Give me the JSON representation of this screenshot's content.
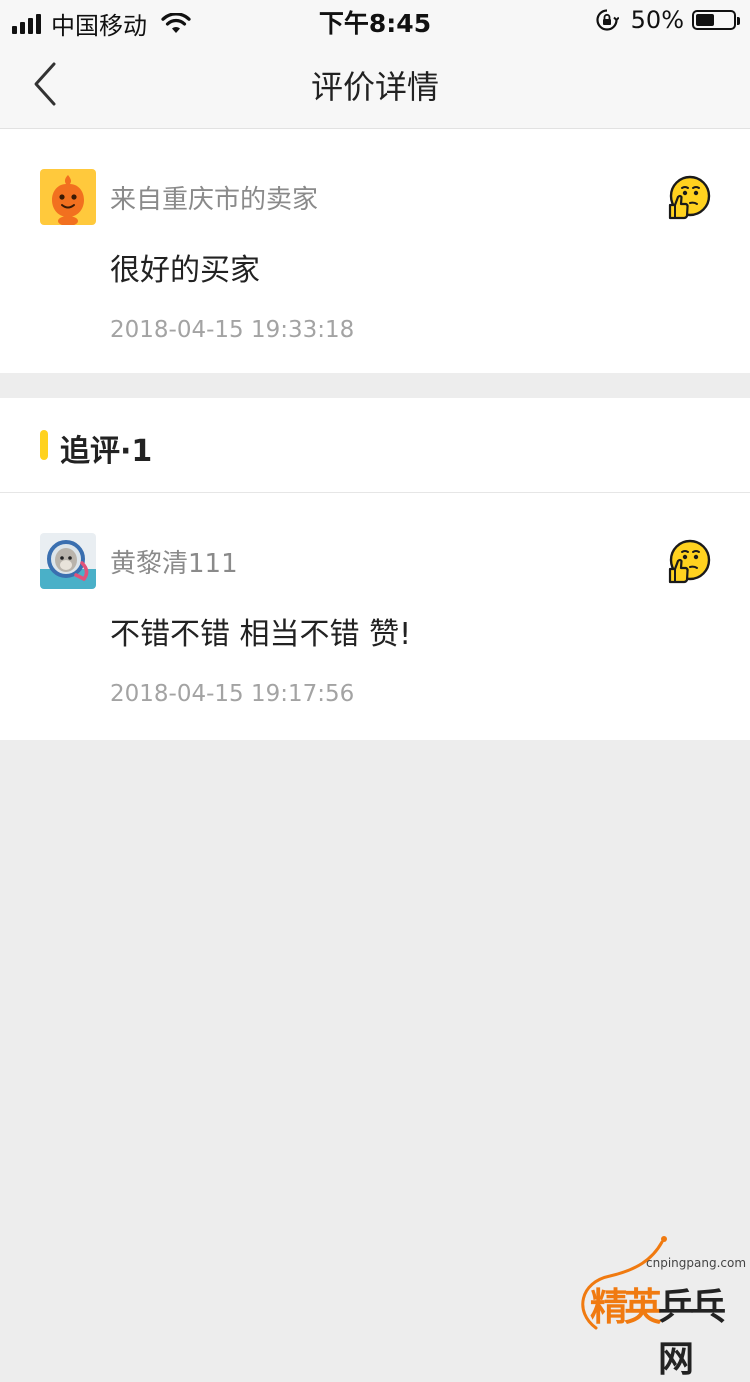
{
  "status_bar": {
    "carrier": "中国移动",
    "time": "下午8:45",
    "battery_percent": "50%",
    "battery_level": 0.5,
    "signal_bars": 4
  },
  "nav": {
    "title": "评价详情",
    "back_icon": "chevron-left-icon"
  },
  "review": {
    "user": "来自重庆市的卖家",
    "text": "很好的买家",
    "time": "2018-04-15 19:33:18",
    "rating_icon": "thumbs-up-face-icon"
  },
  "followup_section": {
    "title": "追评·1"
  },
  "followup": {
    "user": "黄黎清111",
    "text": "不错不错 相当不错 赞!",
    "time": "2018-04-15 19:17:56",
    "rating_icon": "thumbs-up-face-icon"
  },
  "watermark": {
    "site": "cnpingpang.com",
    "name_a": "精英",
    "name_b": "乒乓网"
  },
  "colors": {
    "accent_yellow": "#ffd21f",
    "page_bg": "#ededed",
    "watermark_orange": "#f07a10"
  }
}
